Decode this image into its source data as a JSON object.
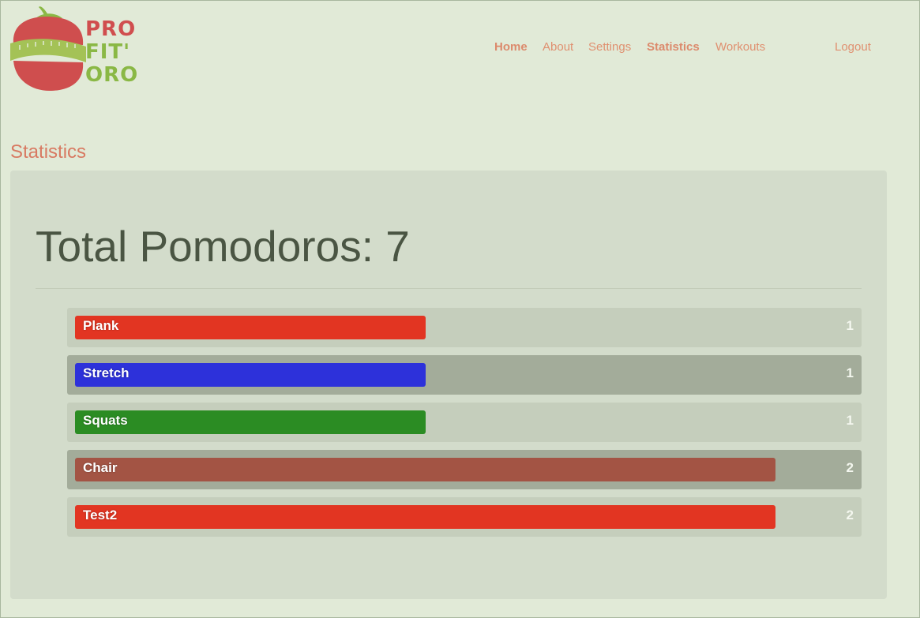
{
  "header": {
    "logo_text": [
      "PRO",
      "FIT'",
      "ORO"
    ],
    "logo_colors": {
      "tomato": "#d04e4e",
      "tape": "#a4c256",
      "green": "#8ab845"
    }
  },
  "nav": {
    "items": [
      {
        "label": "Home",
        "bold": true
      },
      {
        "label": "About",
        "bold": false
      },
      {
        "label": "Settings",
        "bold": false
      },
      {
        "label": "Statistics",
        "bold": true
      },
      {
        "label": "Workouts",
        "bold": false
      },
      {
        "label": "Logout",
        "bold": false
      }
    ]
  },
  "page": {
    "title": "Statistics",
    "total_heading": "Total Pomodoros: 7"
  },
  "stats": {
    "max_count": 2,
    "items": [
      {
        "name": "Plank",
        "count": "1",
        "value": 1,
        "color": "#e23522"
      },
      {
        "name": "Stretch",
        "count": "1",
        "value": 1,
        "color": "#2d31da"
      },
      {
        "name": "Squats",
        "count": "1",
        "value": 1,
        "color": "#2b8c23"
      },
      {
        "name": "Chair",
        "count": "2",
        "value": 2,
        "color": "#a35444"
      },
      {
        "name": "Test2",
        "count": "2",
        "value": 2,
        "color": "#e23522"
      }
    ]
  }
}
